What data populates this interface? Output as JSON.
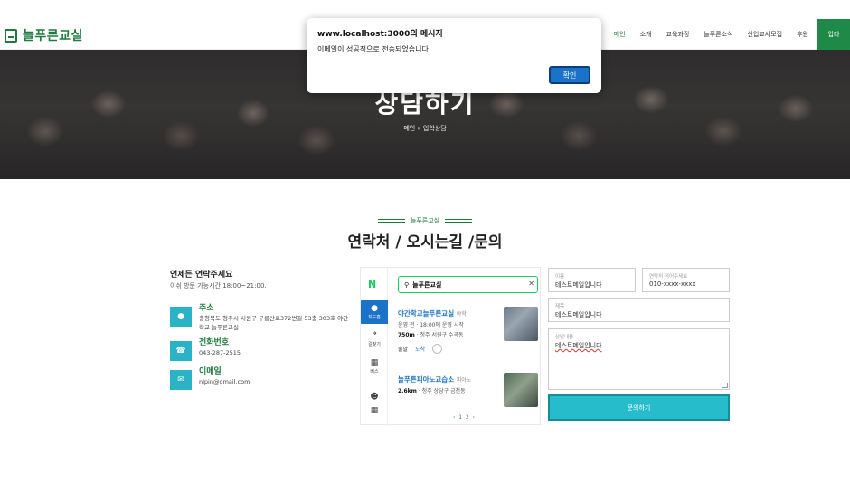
{
  "header": {
    "logo_text": "늘푸른교실",
    "nav": [
      "메인",
      "소개",
      "교육과정",
      "늘푸른소식",
      "신입교사모집",
      "후원"
    ],
    "login_label": "입타"
  },
  "hero": {
    "title": "상담하기",
    "breadcrumb": "메인 » 입학상담"
  },
  "dialog": {
    "title": "www.localhost:3000의 메시지",
    "message": "이메일이 성공적으로 전송되었습니다!",
    "ok_label": "확인"
  },
  "section": {
    "subtitle": "늘푸른교실",
    "title": "연락처 / 오시는길 /문의"
  },
  "contact": {
    "title": "언제든 연락주세요",
    "hours": "이쉬 방문 가능시간 18:00~21:00.",
    "address_label": "주소",
    "address_value": "충청북도 청주시 서원구 구룡산로372번길 53충 303호 야간학교 늘푸른교실",
    "phone_label": "전화번호",
    "phone_value": "043-287-2515",
    "email_label": "이메일",
    "email_value": "nlpin@gmail.com"
  },
  "map": {
    "brand": "N",
    "side_buttons": [
      "지도홈",
      "길찾기",
      "버스"
    ],
    "search_query": "늘푸른교실",
    "results": [
      {
        "name": "야간학교늘푸른교실",
        "category": "야학",
        "status": "운영 전 · 18:00에 운영 시작",
        "distance": "750m",
        "area": "· 청주 서원구 수곡동"
      },
      {
        "name": "늘푸른피아노교습소",
        "category": "피아노",
        "distance": "2.6km",
        "area": "· 청주 상당구 금천동"
      }
    ],
    "tags": [
      "출발",
      "도착"
    ],
    "pages": [
      "1",
      "2"
    ]
  },
  "form": {
    "name_label": "이름",
    "name_value": "테스트메일입니다",
    "phone_label": "연락처 적어주세요",
    "phone_value": "010-xxxx-xxxx",
    "subject_label": "제목",
    "subject_value": "테스트메일입니다",
    "content_label": "상담내용",
    "content_value": "테스트메일입니다",
    "submit_label": "문의하기"
  },
  "colors": {
    "brand_green": "#1f7a3f",
    "accent_teal": "#27bccc",
    "naver_green": "#19ce60",
    "dialog_blue": "#1a73c8"
  }
}
